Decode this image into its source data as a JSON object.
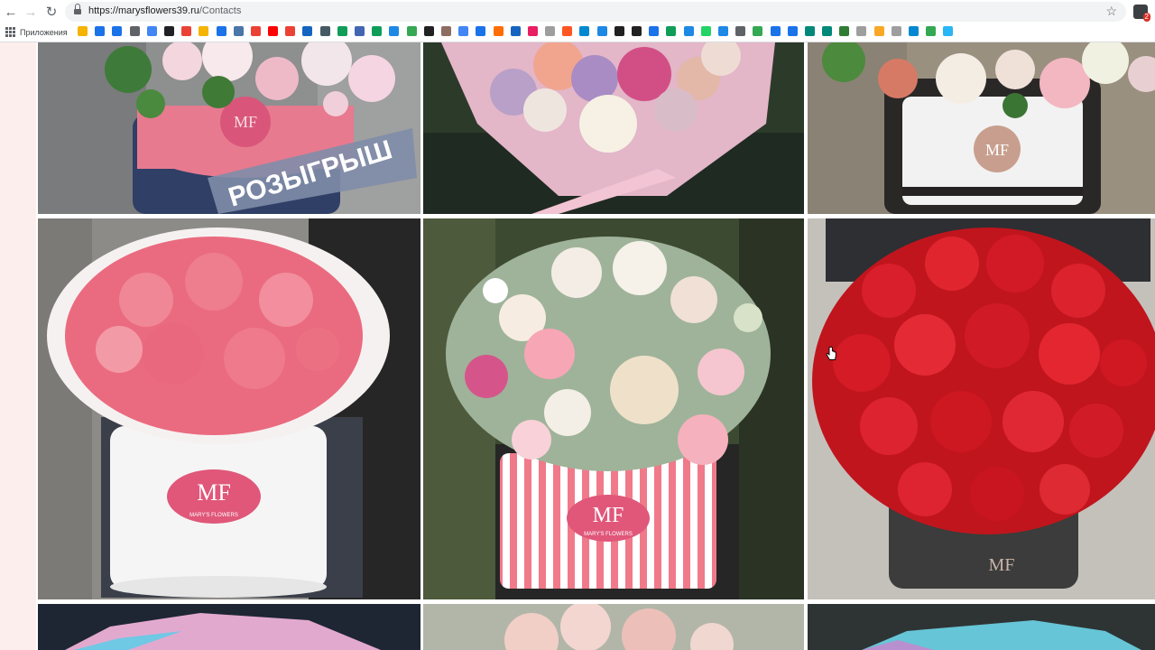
{
  "browser": {
    "url_host": "https://marysflowers39.ru",
    "url_path": "/Contacts",
    "bookmarks_apps_label": "Приложения",
    "extension_badge": "2",
    "bookmark_colors": [
      "#f4b400",
      "#1a73e8",
      "#1a73e8",
      "#5f6368",
      "#4285f4",
      "#202124",
      "#ea4335",
      "#f4b400",
      "#1a73e8",
      "#4a76a8",
      "#ea4335",
      "#ff0000",
      "#ea4335",
      "#1565c0",
      "#455a64",
      "#0f9d58",
      "#4267b2",
      "#0f9d58",
      "#1e88e5",
      "#34a853",
      "#212121",
      "#8d6e63",
      "#4285f4",
      "#1a73e8",
      "#ff6d00",
      "#1565c0",
      "#e91e63",
      "#9e9e9e",
      "#ff5722",
      "#0288d1",
      "#1e88e5",
      "#212121",
      "#212121",
      "#1a73e8",
      "#0f9d58",
      "#1e88e5",
      "#25d366",
      "#1e88e5",
      "#5f6368",
      "#34a853",
      "#1a73e8",
      "#1a73e8",
      "#00897b",
      "#00897b",
      "#2e7d32",
      "#9e9e9e",
      "#f9a825",
      "#9e9e9e",
      "#0288d1",
      "#34a853",
      "#29b6f6"
    ]
  },
  "gallery": {
    "tiles": [
      {
        "id": "top-left",
        "overlay_text": "РОЗЫГРЫШ",
        "logo": "MF"
      },
      {
        "id": "top-middle"
      },
      {
        "id": "top-right",
        "logo": "MF"
      },
      {
        "id": "mid-left",
        "logo": "MF",
        "logo_sub": "MARY'S FLOWERS"
      },
      {
        "id": "mid-middle",
        "logo": "MF",
        "logo_sub": "MARY'S FLOWERS"
      },
      {
        "id": "mid-right",
        "logo": "MF"
      },
      {
        "id": "bottom-left"
      },
      {
        "id": "bottom-middle"
      },
      {
        "id": "bottom-right"
      }
    ]
  }
}
